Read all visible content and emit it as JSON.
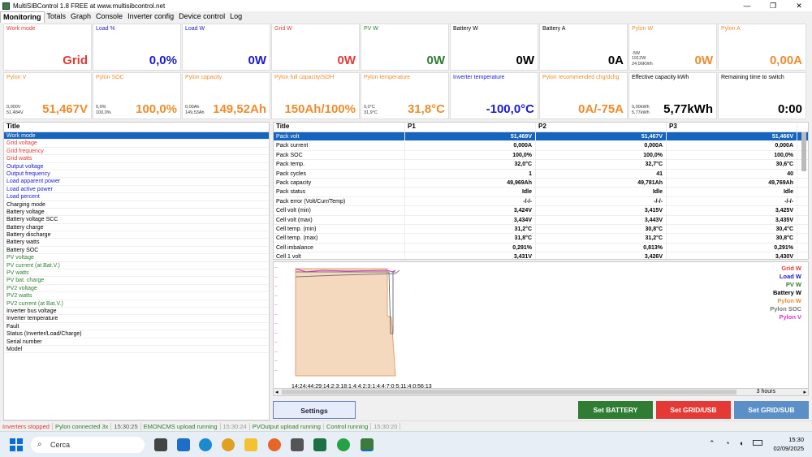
{
  "window": {
    "title": "MultiSIBControl 1.8 FREE at www.multisibcontrol.net",
    "controls": [
      "—",
      "❐",
      "✕"
    ]
  },
  "menu": [
    "Monitoring",
    "Totals",
    "Graph",
    "Console",
    "Inverter config",
    "Device control",
    "Log"
  ],
  "tiles_row1": [
    {
      "label": "Work mode",
      "value": "Grid",
      "color": "#e53935",
      "sub": ""
    },
    {
      "label": "Load %",
      "value": "0,0%",
      "color": "#1a1ad6",
      "sub": ""
    },
    {
      "label": "Load W",
      "value": "0W",
      "color": "#1a1ad6",
      "sub": ""
    },
    {
      "label": "Grid W",
      "value": "0W",
      "color": "#e53935",
      "sub": ""
    },
    {
      "label": "PV W",
      "value": "0W",
      "color": "#2e7d32",
      "sub": ""
    },
    {
      "label": "Battery W",
      "value": "0W",
      "color": "#000000",
      "sub": ""
    },
    {
      "label": "Battery A",
      "value": "0A",
      "color": "#000000",
      "sub": ""
    },
    {
      "label": "Pylon W",
      "value": "0W",
      "color": "#f08c2c",
      "sub": "-5W\n1912W\n24,06KWh"
    },
    {
      "label": "Pylon A",
      "value": "0,00A",
      "color": "#f08c2c",
      "sub": ""
    }
  ],
  "tiles_row2": [
    {
      "label": "Pylon V",
      "value": "51,467V",
      "color": "#f08c2c",
      "sub": "0,000V\n51,484V"
    },
    {
      "label": "Pylon SOC",
      "value": "100,0%",
      "color": "#f08c2c",
      "sub": "0,0%\n100,0%"
    },
    {
      "label": "Pylon capacity",
      "value": "149,52Ah",
      "color": "#f08c2c",
      "sub": "0,00Ah\n149,53Ah"
    },
    {
      "label": "Pylon full capacity/SOH",
      "value": "150Ah/100%",
      "color": "#f08c2c",
      "sub": ""
    },
    {
      "label": "Pylon temperature",
      "value": "31,8°C",
      "color": "#f08c2c",
      "sub": "0,0°C\n31,9°C"
    },
    {
      "label": "Inverter temperature",
      "value": "-100,0°C",
      "color": "#1a1ad6",
      "sub": ""
    },
    {
      "label": "Pylon recommended chg/dchg",
      "value": "0A/-75A",
      "color": "#f08c2c",
      "sub": ""
    },
    {
      "label": "Effective capacity kWh",
      "value": "5,77kWh",
      "color": "#000000",
      "sub": "0,00kWh\n5,77kWh"
    },
    {
      "label": "Remaining time to switch",
      "value": "0:00",
      "color": "#000000",
      "sub": ""
    }
  ],
  "left_list": {
    "header": "Title",
    "items": [
      {
        "label": "Work mode",
        "color": "#ffffff",
        "selected": true
      },
      {
        "label": "Grid voltage",
        "color": "#e53935"
      },
      {
        "label": "Grid frequency",
        "color": "#e53935"
      },
      {
        "label": "Grid watts",
        "color": "#e53935"
      },
      {
        "label": "Output voltage",
        "color": "#1a1ad6"
      },
      {
        "label": "Output frequency",
        "color": "#1a1ad6"
      },
      {
        "label": "Load apparent power",
        "color": "#1a1ad6"
      },
      {
        "label": "Load active power",
        "color": "#1a1ad6"
      },
      {
        "label": "Load percent",
        "color": "#1a1ad6"
      },
      {
        "label": "Charging mode",
        "color": "#000000"
      },
      {
        "label": "Battery voltage",
        "color": "#000000"
      },
      {
        "label": "Battery voltage SCC",
        "color": "#000000"
      },
      {
        "label": "Battery charge",
        "color": "#000000"
      },
      {
        "label": "Battery discharge",
        "color": "#000000"
      },
      {
        "label": "Battery watts",
        "color": "#000000"
      },
      {
        "label": "Battery SOC",
        "color": "#000000"
      },
      {
        "label": "PV voltage",
        "color": "#2e7d32"
      },
      {
        "label": "PV current (at Bat.V.)",
        "color": "#2e7d32"
      },
      {
        "label": "PV watts",
        "color": "#2e7d32"
      },
      {
        "label": "PV bat. charge",
        "color": "#2e7d32"
      },
      {
        "label": "PV2 voltage",
        "color": "#2e7d32"
      },
      {
        "label": "PV2 watts",
        "color": "#2e7d32"
      },
      {
        "label": "PV2 current (at Bat.V.)",
        "color": "#2e7d32"
      },
      {
        "label": "Inverter bus voltage",
        "color": "#000000"
      },
      {
        "label": "Inverter temperature",
        "color": "#000000"
      },
      {
        "label": "Fault",
        "color": "#000000"
      },
      {
        "label": "Status (Inverter/Load/Charge)",
        "color": "#000000"
      },
      {
        "label": "Serial number",
        "color": "#000000"
      },
      {
        "label": "Model",
        "color": "#000000"
      }
    ]
  },
  "pack_table": {
    "headers": [
      "Title",
      "P1",
      "P2",
      "P3"
    ],
    "rows": [
      [
        "Pack volt",
        "51,469V",
        "51,467V",
        "51,466V"
      ],
      [
        "Pack current",
        "0,000A",
        "0,000A",
        "0,000A"
      ],
      [
        "Pack SOC",
        "100,0%",
        "100,0%",
        "100,0%"
      ],
      [
        "Pack temp.",
        "32,0°C",
        "32,7°C",
        "30,6°C"
      ],
      [
        "Pack cycles",
        "1",
        "41",
        "40"
      ],
      [
        "Pack capacity",
        "49,969Ah",
        "49,781Ah",
        "49,769Ah"
      ],
      [
        "Pack status",
        "Idle",
        "Idle",
        "Idle"
      ],
      [
        "Pack error (Volt/Curr/Temp)",
        "-/-/-",
        "-/-/-",
        "-/-/-"
      ],
      [
        "Cell volt (min)",
        "3,424V",
        "3,415V",
        "3,425V"
      ],
      [
        "Cell volt (max)",
        "3,434V",
        "3,443V",
        "3,435V"
      ],
      [
        "Cell temp. (min)",
        "31,2°C",
        "30,8°C",
        "30,4°C"
      ],
      [
        "Cell temp. (max)",
        "31,8°C",
        "31,2°C",
        "30,8°C"
      ],
      [
        "Cell imbalance",
        "0,291%",
        "0,813%",
        "0,291%"
      ],
      [
        "Cell 1 volt",
        "3,431V",
        "3,426V",
        "3,430V"
      ]
    ]
  },
  "graph": {
    "legend": [
      {
        "label": "Grid W",
        "color": "#e53935"
      },
      {
        "label": "Load W",
        "color": "#1a1ad6"
      },
      {
        "label": "PV W",
        "color": "#2e7d32"
      },
      {
        "label": "Battery W",
        "color": "#000000"
      },
      {
        "label": "Pylon W",
        "color": "#f08c2c"
      },
      {
        "label": "Pylon SOC",
        "color": "#777777"
      },
      {
        "label": "Pylon V",
        "color": "#d633d6"
      }
    ],
    "time_label": "14:24:44:29:14:2:3:18:1:4:4:2:3:1:4:4:7:0:5:11:4:0:56:13",
    "range_label": "3 hours",
    "area_color": "#f5d9bf"
  },
  "buttons": {
    "settings": "Settings",
    "set_battery": "Set BATTERY",
    "set_grid_usb": "Set GRID/USB",
    "set_grid_sub": "Set GRID/SUB"
  },
  "status": [
    {
      "text": "Inverters stopped",
      "color": "#e53935"
    },
    {
      "text": "Pylon connected 3x",
      "color": "#2e7d32"
    },
    {
      "text": "15:30:25",
      "color": "#555555"
    },
    {
      "text": "EMONCMS upload running",
      "color": "#2e7d32"
    },
    {
      "text": "15:30:24",
      "color": "#999999"
    },
    {
      "text": "PVOutput upload running",
      "color": "#2e7d32"
    },
    {
      "text": "Control running",
      "color": "#2e7d32"
    },
    {
      "text": "15:30:20",
      "color": "#999999"
    }
  ],
  "taskbar": {
    "search_placeholder": "Cerca",
    "time": "15:30",
    "date": "02/09/2025"
  }
}
